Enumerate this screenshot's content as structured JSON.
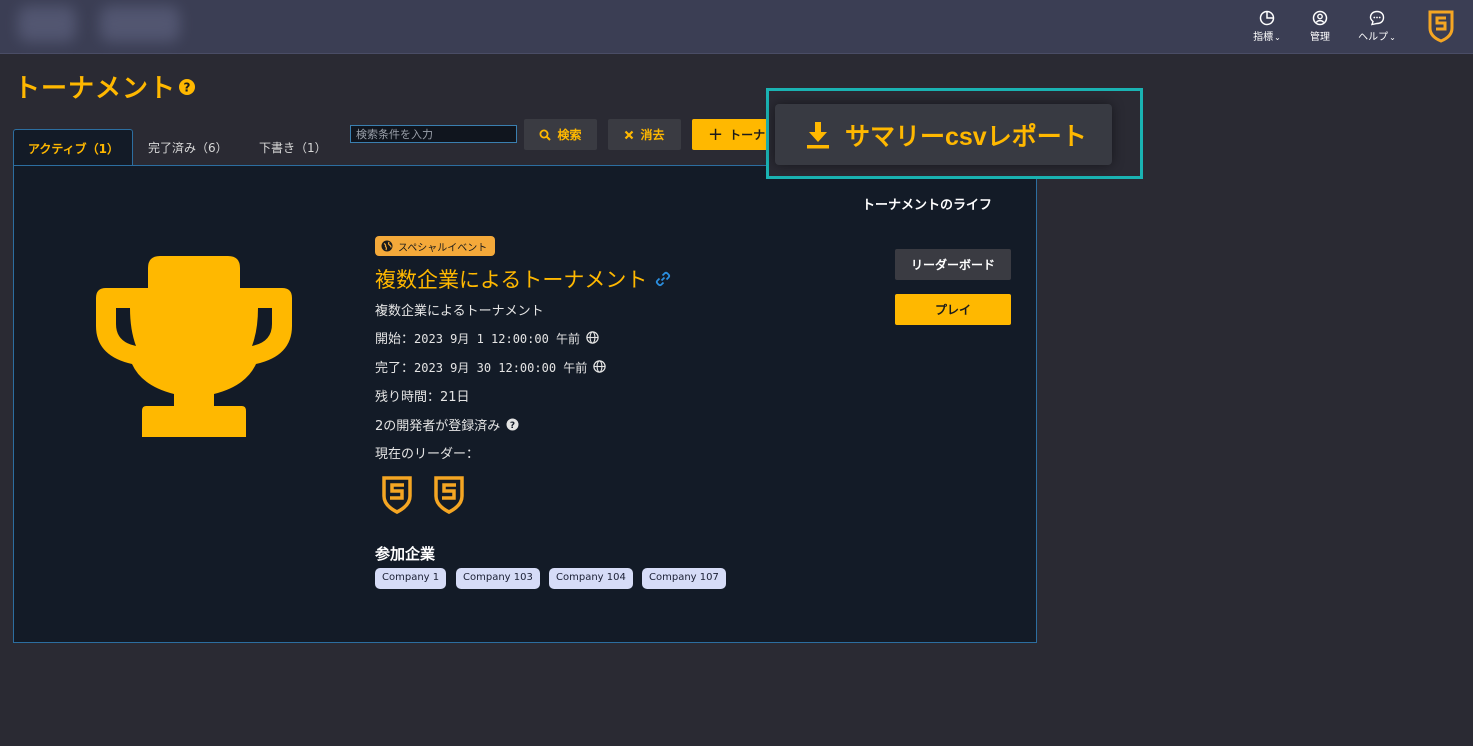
{
  "colors": {
    "accent": "#ffb800",
    "nav_bg": "#3b3e54",
    "panel_bg": "#131b27",
    "highlight": "#1ab3b3",
    "chip_bg": "#d6dcf7"
  },
  "nav": {
    "items": [
      {
        "label": "指標",
        "icon": "pie-chart-icon",
        "chevron": "⌄"
      },
      {
        "label": "管理",
        "icon": "user-circle-icon",
        "chevron": ""
      },
      {
        "label": "ヘルプ",
        "icon": "chat-bubble-icon",
        "chevron": "⌄"
      }
    ],
    "brand_icon": "shield-s-logo"
  },
  "page": {
    "title": "トーナメント"
  },
  "tabs": [
    {
      "label": "アクティブ（1）"
    },
    {
      "label": "完了済み（6）"
    },
    {
      "label": "下書き（1）"
    }
  ],
  "search": {
    "placeholder": "検索条件を入力",
    "search_label": "検索",
    "clear_label": "消去",
    "new_label": "トーナ"
  },
  "summary_csv": {
    "label": "サマリーcsvレポート",
    "icon": "download-icon"
  },
  "tournament": {
    "lifetime_label": "トーナメントのライフ",
    "badge": "スペシャルイベント",
    "title": "複数企業によるトーナメント",
    "description": "複数企業によるトーナメント",
    "start_label": "開始：",
    "start_value": "2023 9月 1 12:00:00 午前",
    "end_label": "完了：",
    "end_value": "2023 9月 30 12:00:00 午前",
    "remaining": "残り時間：21日",
    "registered": "2の開発者が登録済み",
    "leaders_label": "現在のリーダー：",
    "companies_title": "参加企業",
    "companies": [
      "Company 1",
      "Company 103",
      "Company 104",
      "Company 107"
    ],
    "leaderboard_label": "リーダーボード",
    "play_label": "プレイ"
  }
}
